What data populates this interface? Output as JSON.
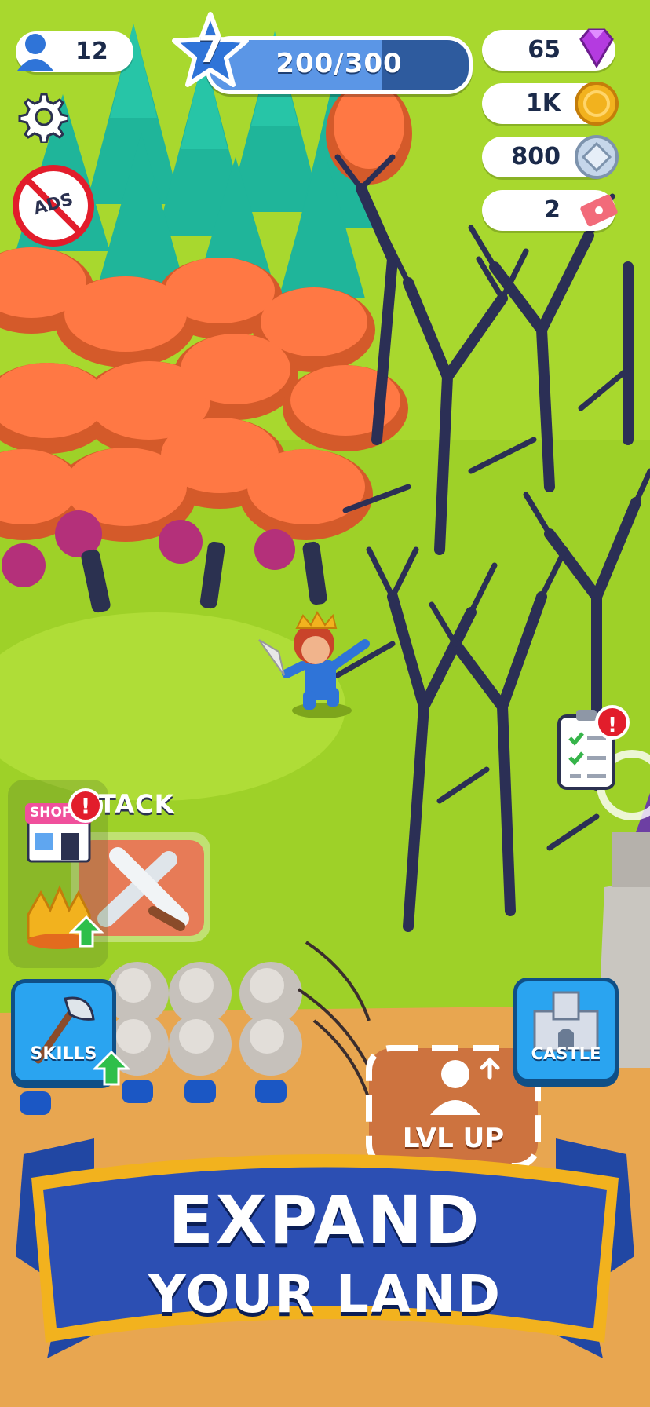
{
  "hud": {
    "players": "12",
    "level": "7",
    "xp_text": "200/300",
    "xp_progress": 0.667,
    "gems": "65",
    "coins": "1K",
    "silver": "800",
    "tickets": "2"
  },
  "buttons": {
    "ads_label": "ADS",
    "shop_label": "SHOP",
    "attack_label": "TACK",
    "skills_label": "SKILLS",
    "castle_label": "CASTLE",
    "lvlup_label": "LVL UP"
  },
  "banner": {
    "line1": "EXPAND",
    "line2": "YOUR LAND"
  },
  "colors": {
    "grass": "#a8d82e",
    "banner_blue": "#2c4fb3",
    "banner_gold": "#f2b21e",
    "hud_blue": "#2f74d8",
    "alert_red": "#e21d2b"
  }
}
